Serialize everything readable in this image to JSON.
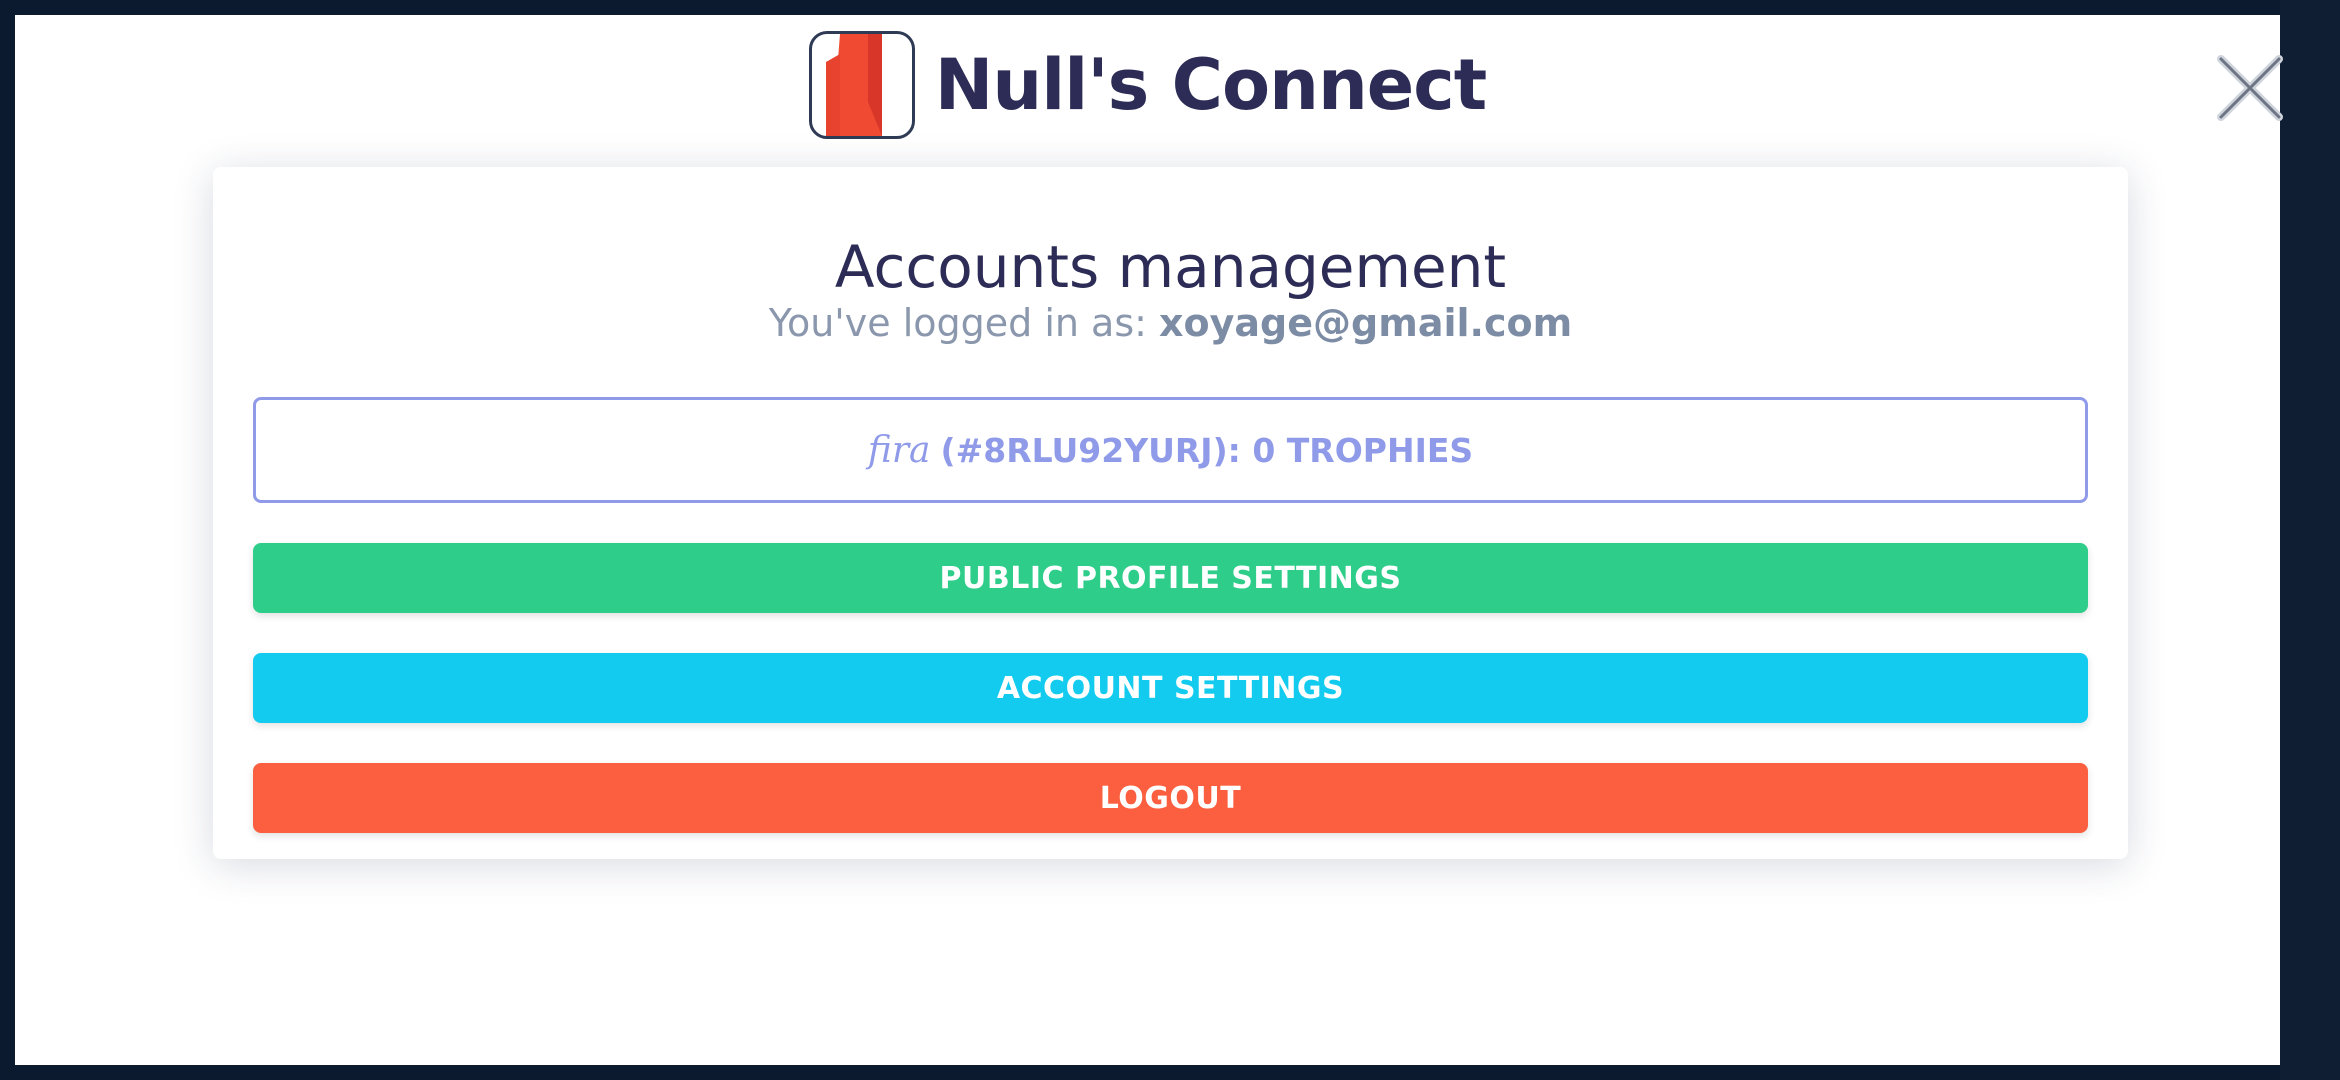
{
  "app": {
    "name": "Null's Connect",
    "logo_letter": "N",
    "close_icon": "close-icon"
  },
  "accounts": {
    "title": "Accounts management",
    "logged_in_prefix": "You've logged in as:",
    "email": "xoyage@gmail.com",
    "account_entry": {
      "name": "fira",
      "details": "(#8RLU92YURJ): 0 TROPHIES"
    }
  },
  "buttons": {
    "public_profile": "PUBLIC PROFILE SETTINGS",
    "account_settings": "ACCOUNT SETTINGS",
    "logout": "LOGOUT"
  },
  "colors": {
    "brand_text": "#2c2c57",
    "logo_red": "#f04b32",
    "public_profile": "#2ecd8a",
    "account_settings": "#12cbee",
    "logout": "#fc5f3f",
    "account_border": "#8f9ae8"
  }
}
